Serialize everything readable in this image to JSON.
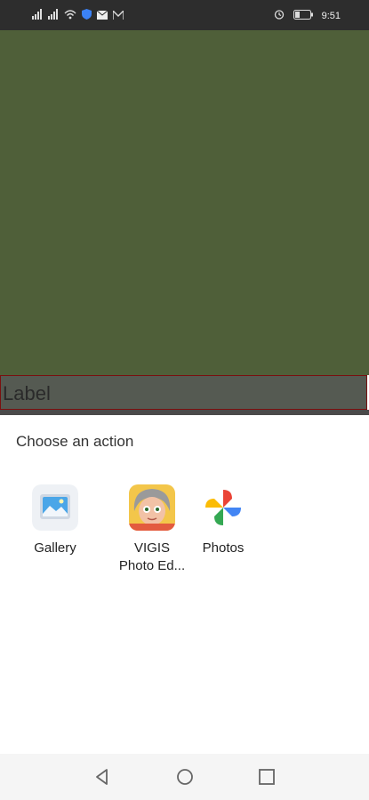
{
  "status_bar": {
    "time": "9:51",
    "icons_left": [
      "signal-icon",
      "signal-icon",
      "wifi-icon",
      "shield-icon",
      "mail-icon",
      "m-icon"
    ],
    "icons_right": [
      "alarm-icon",
      "battery-icon"
    ]
  },
  "content": {
    "label_text": "Label",
    "background_color": "#4f5f39"
  },
  "chooser": {
    "title": "Choose an action",
    "apps": [
      {
        "label": "Gallery"
      },
      {
        "label": "VIGIS\nPhoto Ed..."
      },
      {
        "label": "Photos"
      }
    ]
  },
  "navigation": {
    "buttons": [
      "back-icon",
      "home-icon",
      "recents-icon"
    ]
  }
}
